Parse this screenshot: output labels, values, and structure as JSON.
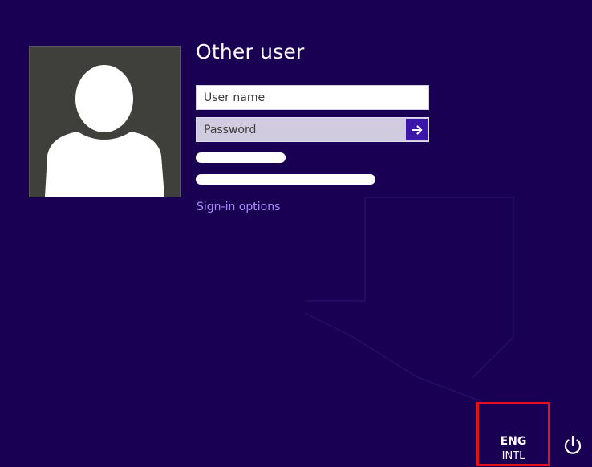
{
  "login": {
    "title": "Other user",
    "username_placeholder": "User name",
    "password_placeholder": "Password",
    "submit_icon": "arrow-right-icon",
    "signin_options": "Sign-in options"
  },
  "avatar": {
    "icon": "user-silhouette-icon"
  },
  "language": {
    "primary": "ENG",
    "secondary": "INTL"
  },
  "power": {
    "icon": "power-icon"
  },
  "colors": {
    "background": "#1a0052",
    "accent": "#3a17a8",
    "link": "#a98cff",
    "highlight_box": "#e8101c"
  }
}
